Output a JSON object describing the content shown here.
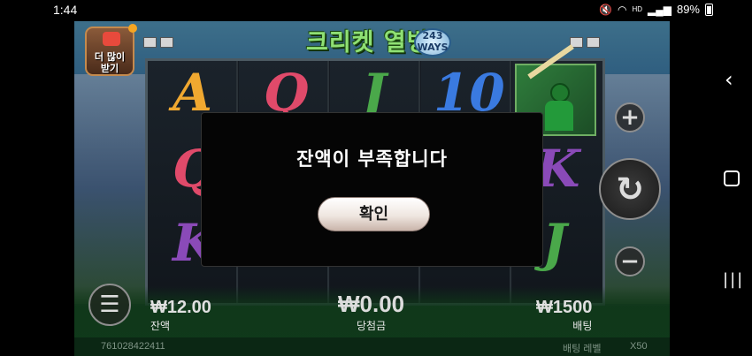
{
  "status_bar": {
    "time": "1:44",
    "battery_percent": "89%",
    "icons": [
      "mute-icon",
      "wifi-icon",
      "volte-icon",
      "signal-icon",
      "battery-icon"
    ]
  },
  "game": {
    "title": "크리켓 열병",
    "ways_badge": "243 WAYS",
    "promo_label": "더 많이\n받기",
    "reels": [
      {
        "symbols": [
          "A",
          "Q",
          "K"
        ],
        "colors": [
          "#f0a830",
          "#e04a6a",
          "#8a4ab8"
        ]
      },
      {
        "symbols": [
          "Q",
          "",
          ""
        ],
        "colors": [
          "#e04a6a",
          "",
          ""
        ]
      },
      {
        "symbols": [
          "J",
          "",
          ""
        ],
        "colors": [
          "#4aa84a",
          "",
          ""
        ]
      },
      {
        "symbols": [
          "10",
          "",
          ""
        ],
        "colors": [
          "#3a7ae0",
          "",
          ""
        ]
      },
      {
        "symbols": [
          "",
          "K",
          "J"
        ],
        "colors": [
          "",
          "#8a4ab8",
          "#4aa84a"
        ]
      }
    ],
    "balance_value": "₩12.00",
    "balance_label": "잔액",
    "win_value": "₩0.00",
    "win_label": "당첨금",
    "bet_value": "₩1500",
    "bet_label": "배팅",
    "round_id": "761028422411",
    "bet_level_label": "배팅 레벨",
    "multiplier": "X50"
  },
  "dialog": {
    "message": "잔액이 부족합니다",
    "confirm_label": "확인"
  },
  "colors": {
    "title_green": "#8fe074",
    "dialog_bg": "#050505",
    "notification": "#f5a623"
  }
}
